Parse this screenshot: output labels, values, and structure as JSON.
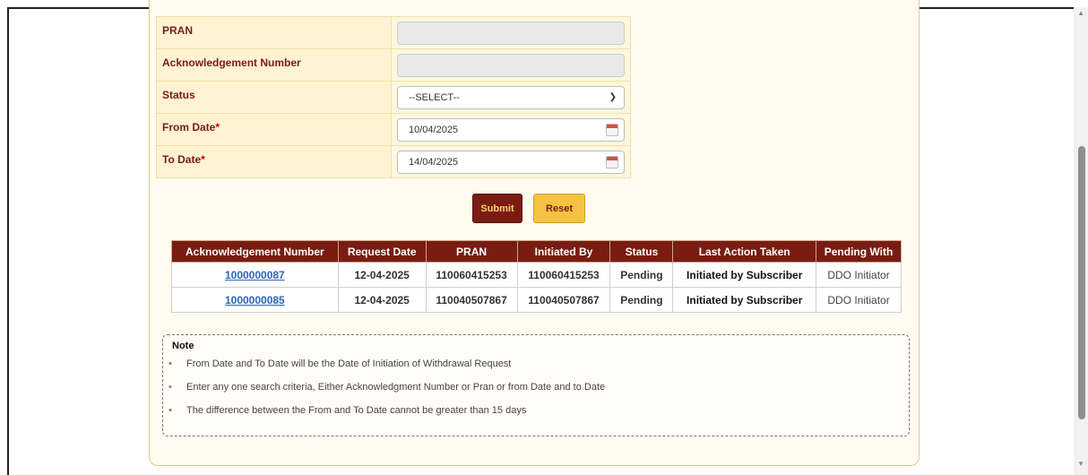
{
  "form": {
    "pran_label": "PRAN",
    "ack_label": "Acknowledgement Number",
    "status_label": "Status",
    "status_value": "--SELECT--",
    "from_date_label": "From Date",
    "from_date_value": "10/04/2025",
    "to_date_label": "To Date",
    "to_date_value": "14/04/2025",
    "required_mark": "*"
  },
  "buttons": {
    "submit": "Submit",
    "reset": "Reset"
  },
  "table": {
    "headers": [
      "Acknowledgement Number",
      "Request Date",
      "PRAN",
      "Initiated By",
      "Status",
      "Last Action Taken",
      "Pending With"
    ],
    "rows": [
      [
        "1000000087",
        "12-04-2025",
        "110060415253",
        "110060415253",
        "Pending",
        "Initiated by Subscriber",
        "DDO Initiator"
      ],
      [
        "1000000085",
        "12-04-2025",
        "110040507867",
        "110040507867",
        "Pending",
        "Initiated by Subscriber",
        "DDO Initiator"
      ]
    ]
  },
  "note": {
    "title": "Note",
    "items": [
      "From Date and To Date will be the Date of Initiation of Withdrawal Request",
      "Enter any one search criteria, Either Acknowledgment Number or Pran or from Date and to Date",
      "The difference between the From and To Date cannot be greater than 15 days"
    ]
  },
  "colors": {
    "primary": "#7a1c12",
    "accent": "#f5c244",
    "link": "#2f64b3"
  },
  "icons": {
    "calendar": "calendar-icon",
    "dropdown": "chevron-down-icon"
  }
}
